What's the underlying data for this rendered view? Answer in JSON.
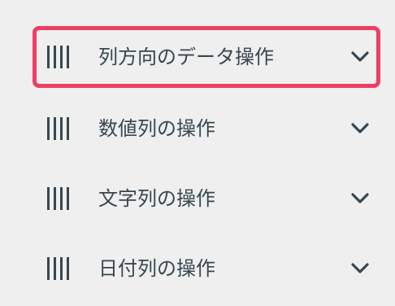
{
  "menu": {
    "items": [
      {
        "label": "列方向のデータ操作",
        "icon": "columns-icon",
        "expand_icon": "chevron-down-icon",
        "selected": true
      },
      {
        "label": "数値列の操作",
        "icon": "columns-icon",
        "expand_icon": "chevron-down-icon",
        "selected": false
      },
      {
        "label": "文字列の操作",
        "icon": "columns-icon",
        "expand_icon": "chevron-down-icon",
        "selected": false
      },
      {
        "label": "日付列の操作",
        "icon": "columns-icon",
        "expand_icon": "chevron-down-icon",
        "selected": false
      }
    ]
  },
  "colors": {
    "background": "#efefef",
    "text": "#37474f",
    "icon": "#37474f",
    "selection_border": "#ee3e63"
  }
}
